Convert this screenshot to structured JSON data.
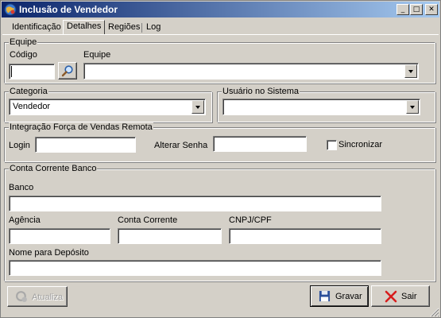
{
  "window": {
    "title": "Inclusão de Vendedor",
    "minimize_glyph": "_",
    "maximize_glyph": "□",
    "close_glyph": "✕"
  },
  "tabs": [
    {
      "label": "Identificação"
    },
    {
      "label": "Detalhes"
    },
    {
      "label": "Regiões"
    },
    {
      "label": "Log"
    }
  ],
  "active_tab": "Detalhes",
  "equipe": {
    "group_label": "Equipe",
    "codigo_label": "Código",
    "codigo_value": "",
    "equipe_label": "Equipe",
    "equipe_value": ""
  },
  "categoria": {
    "group_label": "Categoria",
    "value": "Vendedor"
  },
  "usuario": {
    "group_label": "Usuário no Sistema",
    "value": ""
  },
  "integracao": {
    "group_label": "Integração Força de Vendas Remota",
    "login_label": "Login",
    "login_value": "",
    "senha_label": "Alterar Senha",
    "senha_value": "",
    "sincronizar_label": "Sincronizar",
    "sincronizar_checked": false
  },
  "conta": {
    "group_label": "Conta Corrente Banco",
    "banco_label": "Banco",
    "banco_value": "",
    "agencia_label": "Agência",
    "agencia_value": "",
    "conta_label": "Conta Corrente",
    "conta_value": "",
    "cnpj_label": "CNPJ/CPF",
    "cnpj_value": "",
    "deposito_label": "Nome para Depósito",
    "deposito_value": ""
  },
  "buttons": {
    "atualiza": "Atualiza",
    "gravar": "Gravar",
    "sair": "Sair"
  },
  "icons": {
    "app": "app-globe-icon",
    "search": "magnifier-icon",
    "atualiza": "refresh-icon",
    "gravar": "floppy-disk-icon",
    "sair": "red-x-icon"
  },
  "colors": {
    "title_gradient_start": "#0a246a",
    "title_gradient_end": "#a6caf0",
    "face": "#d4d0c8"
  }
}
